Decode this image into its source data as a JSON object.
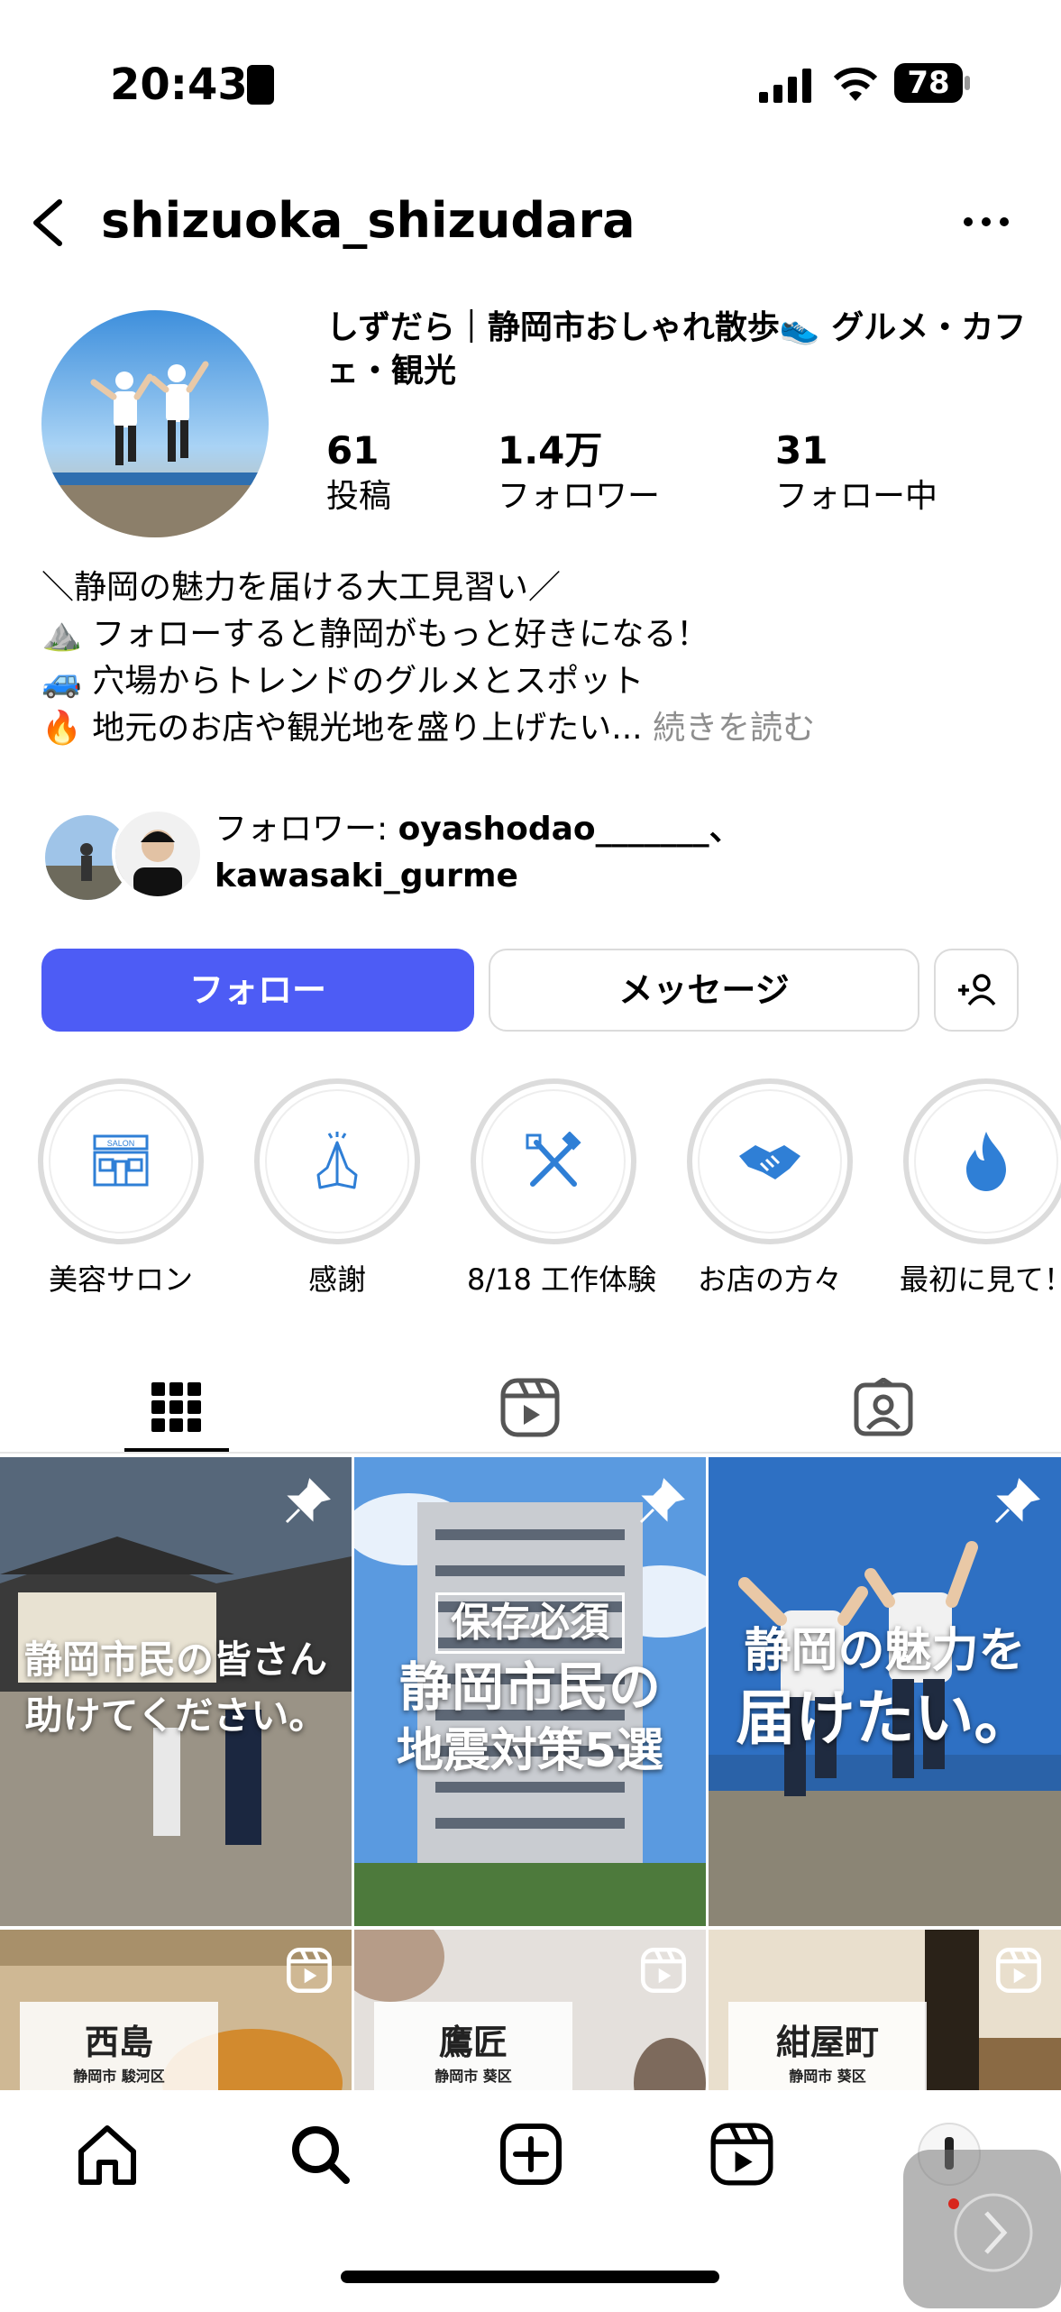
{
  "status_bar": {
    "time": "20:43",
    "battery": "78"
  },
  "header": {
    "username": "shizuoka_shizudara"
  },
  "profile": {
    "name_line": "しずだら｜静岡市おしゃれ散歩👟 グルメ・カフェ・観光",
    "stats": [
      {
        "value": "61",
        "label": "投稿"
      },
      {
        "value": "1.4万",
        "label": "フォロワー"
      },
      {
        "value": "31",
        "label": "フォロー中"
      }
    ],
    "bio": [
      "＼静岡の魅力を届ける大工見習い／",
      "⛰️ フォローすると静岡がもっと好きになる！",
      "🚙 穴場からトレンドのグルメとスポット",
      "🔥 地元のお店や観光地を盛り上げたい..."
    ],
    "read_more": "続きを読む",
    "mutual_prefix": "フォロワー: ",
    "mutual_line1": "oyashodao_______、",
    "mutual_line2": "kawasaki_gurme"
  },
  "actions": {
    "follow": "フォロー",
    "message": "メッセージ"
  },
  "highlights": [
    {
      "label": "美容サロン",
      "icon": "salon-icon"
    },
    {
      "label": "感謝",
      "icon": "praying-hands-icon"
    },
    {
      "label": "8/18 工作体験",
      "icon": "tools-icon"
    },
    {
      "label": "お店の方々",
      "icon": "handshake-icon"
    },
    {
      "label": "最初に見て！",
      "icon": "flame-icon"
    }
  ],
  "posts": [
    {
      "text_line1": "静岡市民の皆さん",
      "text_line2": "助けてください。",
      "pinned": true
    },
    {
      "text_tag": "保存必須",
      "text_line1": "静岡市民の",
      "text_line2": "地震対策5選",
      "pinned": true
    },
    {
      "text_line1": "静岡の魅力を",
      "text_line2": "届けたい。",
      "pinned": true
    },
    {
      "place": "西島",
      "sub": "静岡市 駿河区",
      "type": "reel"
    },
    {
      "place": "鷹匠",
      "sub": "静岡市 葵区",
      "type": "reel"
    },
    {
      "place": "紺屋町",
      "sub": "静岡市 葵区",
      "type": "reel"
    }
  ],
  "colors": {
    "accent": "#4d5cf5",
    "highlight_icon": "#2f7fd6"
  }
}
